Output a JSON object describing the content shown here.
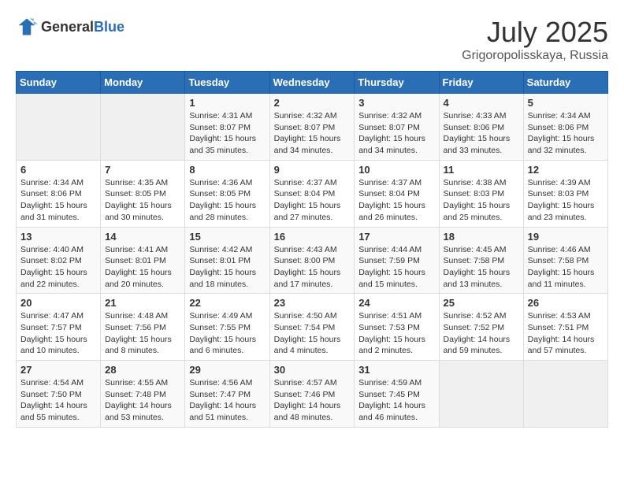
{
  "header": {
    "logo": {
      "general": "General",
      "blue": "Blue"
    },
    "title": "July 2025",
    "location": "Grigoropolisskaya, Russia"
  },
  "weekdays": [
    "Sunday",
    "Monday",
    "Tuesday",
    "Wednesday",
    "Thursday",
    "Friday",
    "Saturday"
  ],
  "weeks": [
    [
      {
        "day": "",
        "sunrise": "",
        "sunset": "",
        "daylight": ""
      },
      {
        "day": "",
        "sunrise": "",
        "sunset": "",
        "daylight": ""
      },
      {
        "day": "1",
        "sunrise": "Sunrise: 4:31 AM",
        "sunset": "Sunset: 8:07 PM",
        "daylight": "Daylight: 15 hours and 35 minutes."
      },
      {
        "day": "2",
        "sunrise": "Sunrise: 4:32 AM",
        "sunset": "Sunset: 8:07 PM",
        "daylight": "Daylight: 15 hours and 34 minutes."
      },
      {
        "day": "3",
        "sunrise": "Sunrise: 4:32 AM",
        "sunset": "Sunset: 8:07 PM",
        "daylight": "Daylight: 15 hours and 34 minutes."
      },
      {
        "day": "4",
        "sunrise": "Sunrise: 4:33 AM",
        "sunset": "Sunset: 8:06 PM",
        "daylight": "Daylight: 15 hours and 33 minutes."
      },
      {
        "day": "5",
        "sunrise": "Sunrise: 4:34 AM",
        "sunset": "Sunset: 8:06 PM",
        "daylight": "Daylight: 15 hours and 32 minutes."
      }
    ],
    [
      {
        "day": "6",
        "sunrise": "Sunrise: 4:34 AM",
        "sunset": "Sunset: 8:06 PM",
        "daylight": "Daylight: 15 hours and 31 minutes."
      },
      {
        "day": "7",
        "sunrise": "Sunrise: 4:35 AM",
        "sunset": "Sunset: 8:05 PM",
        "daylight": "Daylight: 15 hours and 30 minutes."
      },
      {
        "day": "8",
        "sunrise": "Sunrise: 4:36 AM",
        "sunset": "Sunset: 8:05 PM",
        "daylight": "Daylight: 15 hours and 28 minutes."
      },
      {
        "day": "9",
        "sunrise": "Sunrise: 4:37 AM",
        "sunset": "Sunset: 8:04 PM",
        "daylight": "Daylight: 15 hours and 27 minutes."
      },
      {
        "day": "10",
        "sunrise": "Sunrise: 4:37 AM",
        "sunset": "Sunset: 8:04 PM",
        "daylight": "Daylight: 15 hours and 26 minutes."
      },
      {
        "day": "11",
        "sunrise": "Sunrise: 4:38 AM",
        "sunset": "Sunset: 8:03 PM",
        "daylight": "Daylight: 15 hours and 25 minutes."
      },
      {
        "day": "12",
        "sunrise": "Sunrise: 4:39 AM",
        "sunset": "Sunset: 8:03 PM",
        "daylight": "Daylight: 15 hours and 23 minutes."
      }
    ],
    [
      {
        "day": "13",
        "sunrise": "Sunrise: 4:40 AM",
        "sunset": "Sunset: 8:02 PM",
        "daylight": "Daylight: 15 hours and 22 minutes."
      },
      {
        "day": "14",
        "sunrise": "Sunrise: 4:41 AM",
        "sunset": "Sunset: 8:01 PM",
        "daylight": "Daylight: 15 hours and 20 minutes."
      },
      {
        "day": "15",
        "sunrise": "Sunrise: 4:42 AM",
        "sunset": "Sunset: 8:01 PM",
        "daylight": "Daylight: 15 hours and 18 minutes."
      },
      {
        "day": "16",
        "sunrise": "Sunrise: 4:43 AM",
        "sunset": "Sunset: 8:00 PM",
        "daylight": "Daylight: 15 hours and 17 minutes."
      },
      {
        "day": "17",
        "sunrise": "Sunrise: 4:44 AM",
        "sunset": "Sunset: 7:59 PM",
        "daylight": "Daylight: 15 hours and 15 minutes."
      },
      {
        "day": "18",
        "sunrise": "Sunrise: 4:45 AM",
        "sunset": "Sunset: 7:58 PM",
        "daylight": "Daylight: 15 hours and 13 minutes."
      },
      {
        "day": "19",
        "sunrise": "Sunrise: 4:46 AM",
        "sunset": "Sunset: 7:58 PM",
        "daylight": "Daylight: 15 hours and 11 minutes."
      }
    ],
    [
      {
        "day": "20",
        "sunrise": "Sunrise: 4:47 AM",
        "sunset": "Sunset: 7:57 PM",
        "daylight": "Daylight: 15 hours and 10 minutes."
      },
      {
        "day": "21",
        "sunrise": "Sunrise: 4:48 AM",
        "sunset": "Sunset: 7:56 PM",
        "daylight": "Daylight: 15 hours and 8 minutes."
      },
      {
        "day": "22",
        "sunrise": "Sunrise: 4:49 AM",
        "sunset": "Sunset: 7:55 PM",
        "daylight": "Daylight: 15 hours and 6 minutes."
      },
      {
        "day": "23",
        "sunrise": "Sunrise: 4:50 AM",
        "sunset": "Sunset: 7:54 PM",
        "daylight": "Daylight: 15 hours and 4 minutes."
      },
      {
        "day": "24",
        "sunrise": "Sunrise: 4:51 AM",
        "sunset": "Sunset: 7:53 PM",
        "daylight": "Daylight: 15 hours and 2 minutes."
      },
      {
        "day": "25",
        "sunrise": "Sunrise: 4:52 AM",
        "sunset": "Sunset: 7:52 PM",
        "daylight": "Daylight: 14 hours and 59 minutes."
      },
      {
        "day": "26",
        "sunrise": "Sunrise: 4:53 AM",
        "sunset": "Sunset: 7:51 PM",
        "daylight": "Daylight: 14 hours and 57 minutes."
      }
    ],
    [
      {
        "day": "27",
        "sunrise": "Sunrise: 4:54 AM",
        "sunset": "Sunset: 7:50 PM",
        "daylight": "Daylight: 14 hours and 55 minutes."
      },
      {
        "day": "28",
        "sunrise": "Sunrise: 4:55 AM",
        "sunset": "Sunset: 7:48 PM",
        "daylight": "Daylight: 14 hours and 53 minutes."
      },
      {
        "day": "29",
        "sunrise": "Sunrise: 4:56 AM",
        "sunset": "Sunset: 7:47 PM",
        "daylight": "Daylight: 14 hours and 51 minutes."
      },
      {
        "day": "30",
        "sunrise": "Sunrise: 4:57 AM",
        "sunset": "Sunset: 7:46 PM",
        "daylight": "Daylight: 14 hours and 48 minutes."
      },
      {
        "day": "31",
        "sunrise": "Sunrise: 4:59 AM",
        "sunset": "Sunset: 7:45 PM",
        "daylight": "Daylight: 14 hours and 46 minutes."
      },
      {
        "day": "",
        "sunrise": "",
        "sunset": "",
        "daylight": ""
      },
      {
        "day": "",
        "sunrise": "",
        "sunset": "",
        "daylight": ""
      }
    ]
  ]
}
